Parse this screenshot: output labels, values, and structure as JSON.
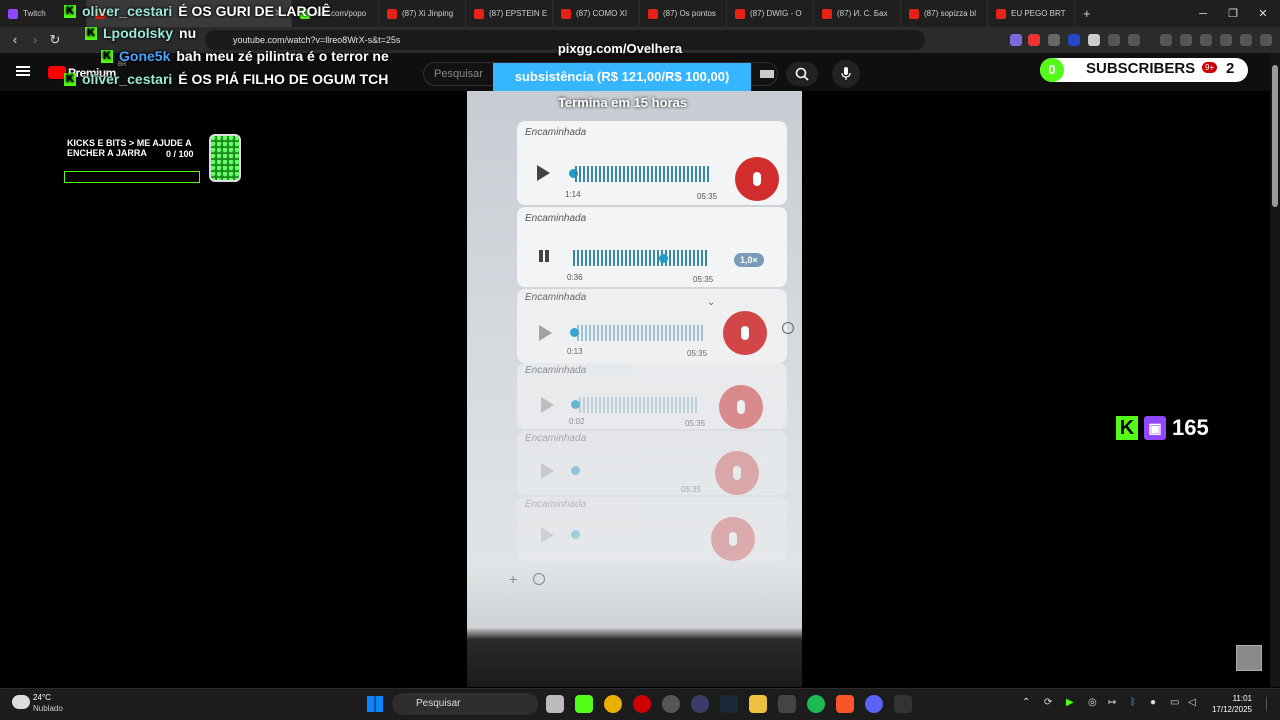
{
  "browser": {
    "tabs": [
      {
        "label": "Twitch",
        "icon": "twitch-icon"
      },
      {
        "label": "kick.com/popo",
        "icon": "kick-icon"
      },
      {
        "label": "(87) Xi Jinping",
        "icon": "youtube-icon"
      },
      {
        "label": "(87) EPSTEIN E",
        "icon": "youtube-icon"
      },
      {
        "label": "(87) COMO XI",
        "icon": "youtube-icon"
      },
      {
        "label": "(87) Os pontos",
        "icon": "youtube-icon"
      },
      {
        "label": "(87) DWIG - O",
        "icon": "youtube-icon"
      },
      {
        "label": "(87) И. С. Бах",
        "icon": "youtube-icon"
      },
      {
        "label": "(87) sopizza bl",
        "icon": "youtube-icon"
      },
      {
        "label": "EU PEGO BRT",
        "icon": "youtube-icon"
      }
    ],
    "new_tab": "+",
    "url": "youtube.com/watch?v=llreo8WrX-s&t=25s"
  },
  "youtube": {
    "logo_text": "Premium",
    "region": "BR",
    "search_placeholder": "Pesquisar"
  },
  "chat": [
    {
      "user": "oliver_cestari",
      "message": "É OS GURI DE LAROIÊ",
      "color": "#9be8d8"
    },
    {
      "user": "Lpodolsky",
      "message": "nu",
      "color": "#9be8d8"
    },
    {
      "user": "Gone5k",
      "message": "bah meu zé pilintra é o terror ne",
      "color": "#4aa3ff"
    },
    {
      "user": "oliver_cestari",
      "message": "É OS PIÁ FILHO DE OGUM TCH",
      "color": "#9be8d8"
    }
  ],
  "pix": {
    "site": "pixgg.com/Ovelhera",
    "goal": "subsistência (R$ 121,00/R$ 100,00)",
    "ends": "Termina em 15 horas"
  },
  "jar_goal": {
    "label": "KICKS E BITS > ME AJUDE A ENCHER A JARRA",
    "count": "0   / 100",
    "progress": 0
  },
  "video": {
    "messages": [
      {
        "forward": "Encaminhada",
        "time": "1:14",
        "duration": "05:35"
      },
      {
        "forward": "Encaminhada",
        "time": "0:36",
        "duration": "05:35",
        "speed": "1,0×"
      },
      {
        "forward": "Encaminhada",
        "time": "0:13",
        "duration": "05:35"
      },
      {
        "forward": "Encaminhada",
        "time": "0:02",
        "duration": "05:35"
      },
      {
        "forward": "Encaminhada",
        "time": "",
        "duration": "05:35"
      },
      {
        "forward": "Encaminhada",
        "time": "",
        "duration": ""
      }
    ]
  },
  "subscribers": {
    "count": "0",
    "label": "SUBSCRIBERS",
    "total": "2",
    "notif_badge": "9+"
  },
  "viewers": {
    "count": "165"
  },
  "taskbar": {
    "temperature": "24°C",
    "weather": "Nublado",
    "search": "Pesquisar",
    "time": "11:01",
    "date": "17/12/2025"
  }
}
